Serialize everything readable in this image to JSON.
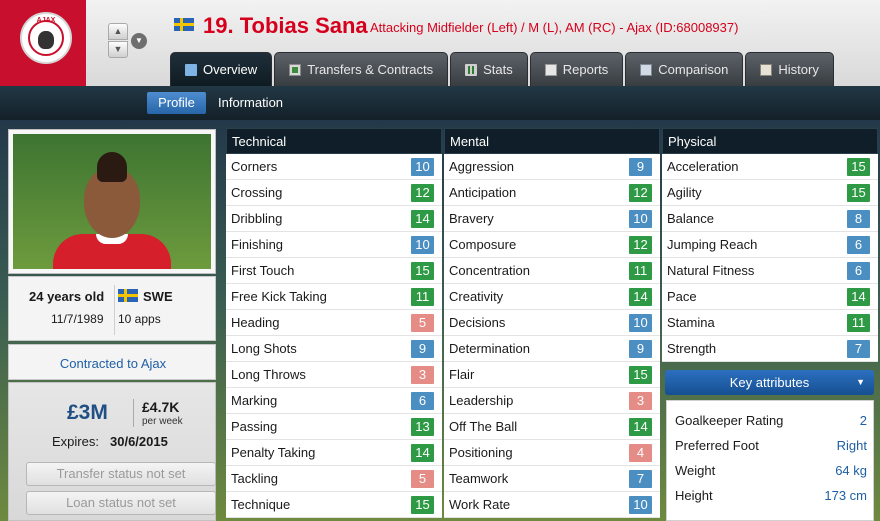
{
  "header": {
    "player_name": "19. Tobias Sana",
    "player_subtitle": "Attacking Midfielder (Left) / M (L), AM (RC) - Ajax (ID:68008937)",
    "club_badge_text": "AJAX",
    "colors": {
      "name_red": "#d6001c",
      "club_red": "#c8102e"
    }
  },
  "tabs": [
    {
      "label": "Overview",
      "icon": "overview-icon",
      "active": true
    },
    {
      "label": "Transfers & Contracts",
      "icon": "contracts-icon",
      "active": false
    },
    {
      "label": "Stats",
      "icon": "stats-icon",
      "active": false
    },
    {
      "label": "Reports",
      "icon": "reports-icon",
      "active": false
    },
    {
      "label": "Comparison",
      "icon": "comparison-icon",
      "active": false
    },
    {
      "label": "History",
      "icon": "history-icon",
      "active": false
    }
  ],
  "subnav": {
    "profile": "Profile",
    "information": "Information"
  },
  "profile": {
    "age": "24 years old",
    "dob": "11/7/1989",
    "nation": "SWE",
    "apps": "10 apps",
    "contracted": "Contracted to Ajax",
    "value": "£3M",
    "wage": "£4.7K",
    "per_week": "per week",
    "expires_label": "Expires:",
    "expires_value": "30/6/2015",
    "transfer_status": "Transfer status not set",
    "loan_status": "Loan status not set"
  },
  "technical": {
    "title": "Technical",
    "rows": [
      {
        "name": "Corners",
        "value": "10",
        "color": "blue"
      },
      {
        "name": "Crossing",
        "value": "12",
        "color": "green"
      },
      {
        "name": "Dribbling",
        "value": "14",
        "color": "green"
      },
      {
        "name": "Finishing",
        "value": "10",
        "color": "blue"
      },
      {
        "name": "First Touch",
        "value": "15",
        "color": "green"
      },
      {
        "name": "Free Kick Taking",
        "value": "11",
        "color": "green"
      },
      {
        "name": "Heading",
        "value": "5",
        "color": "red"
      },
      {
        "name": "Long Shots",
        "value": "9",
        "color": "blue"
      },
      {
        "name": "Long Throws",
        "value": "3",
        "color": "red"
      },
      {
        "name": "Marking",
        "value": "6",
        "color": "blue"
      },
      {
        "name": "Passing",
        "value": "13",
        "color": "green"
      },
      {
        "name": "Penalty Taking",
        "value": "14",
        "color": "green"
      },
      {
        "name": "Tackling",
        "value": "5",
        "color": "red"
      },
      {
        "name": "Technique",
        "value": "15",
        "color": "green"
      }
    ]
  },
  "mental": {
    "title": "Mental",
    "rows": [
      {
        "name": "Aggression",
        "value": "9",
        "color": "blue"
      },
      {
        "name": "Anticipation",
        "value": "12",
        "color": "green"
      },
      {
        "name": "Bravery",
        "value": "10",
        "color": "blue"
      },
      {
        "name": "Composure",
        "value": "12",
        "color": "green"
      },
      {
        "name": "Concentration",
        "value": "11",
        "color": "green"
      },
      {
        "name": "Creativity",
        "value": "14",
        "color": "green"
      },
      {
        "name": "Decisions",
        "value": "10",
        "color": "blue"
      },
      {
        "name": "Determination",
        "value": "9",
        "color": "blue"
      },
      {
        "name": "Flair",
        "value": "15",
        "color": "green"
      },
      {
        "name": "Leadership",
        "value": "3",
        "color": "red"
      },
      {
        "name": "Off The Ball",
        "value": "14",
        "color": "green"
      },
      {
        "name": "Positioning",
        "value": "4",
        "color": "red"
      },
      {
        "name": "Teamwork",
        "value": "7",
        "color": "blue"
      },
      {
        "name": "Work Rate",
        "value": "10",
        "color": "blue"
      }
    ]
  },
  "physical": {
    "title": "Physical",
    "rows": [
      {
        "name": "Acceleration",
        "value": "15",
        "color": "green"
      },
      {
        "name": "Agility",
        "value": "15",
        "color": "green"
      },
      {
        "name": "Balance",
        "value": "8",
        "color": "blue"
      },
      {
        "name": "Jumping Reach",
        "value": "6",
        "color": "blue"
      },
      {
        "name": "Natural Fitness",
        "value": "6",
        "color": "blue"
      },
      {
        "name": "Pace",
        "value": "14",
        "color": "green"
      },
      {
        "name": "Stamina",
        "value": "11",
        "color": "green"
      },
      {
        "name": "Strength",
        "value": "7",
        "color": "blue"
      }
    ]
  },
  "key_attributes": {
    "button_label": "Key attributes",
    "rows": [
      {
        "label": "Goalkeeper Rating",
        "value": "2"
      },
      {
        "label": "Preferred Foot",
        "value": "Right"
      },
      {
        "label": "Weight",
        "value": "64 kg"
      },
      {
        "label": "Height",
        "value": "173 cm"
      }
    ]
  }
}
